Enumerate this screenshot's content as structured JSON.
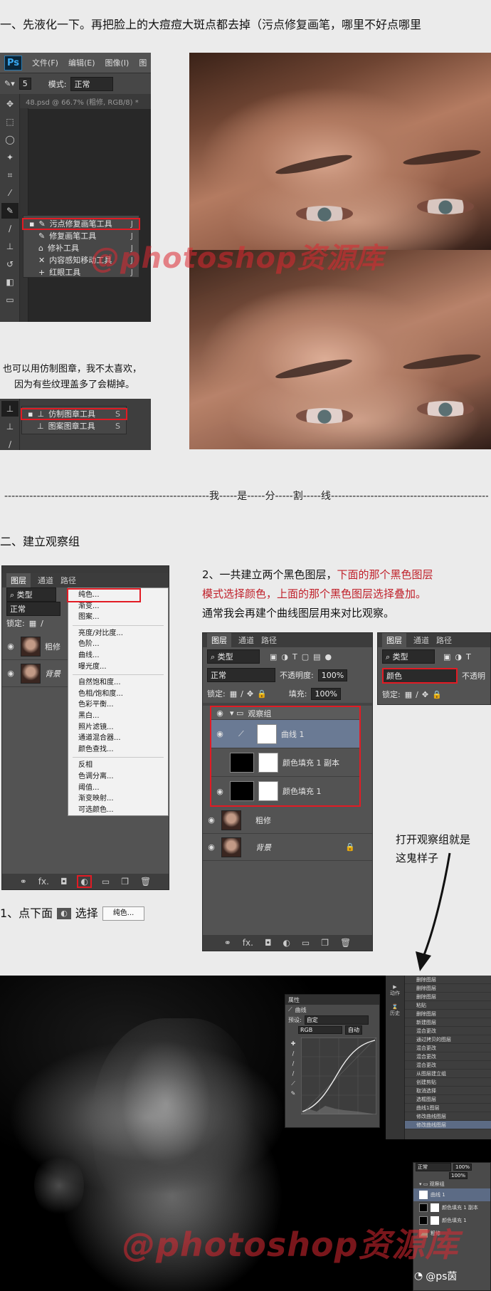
{
  "step1": {
    "heading": "一、先液化一下。再把脸上的大痘痘大斑点都去掉（污点修复画笔，哪里不好点哪里"
  },
  "ps_window1": {
    "app_logo": "Ps",
    "menu": [
      "文件(F)",
      "编辑(E)",
      "图像(I)",
      "图"
    ],
    "brush_size": "5",
    "mode_label": "模式:",
    "mode_value": "正常",
    "doc_tab": "48.psd @ 66.7% (粗修, RGB/8) *",
    "flyout_items": [
      {
        "label": "污点修复画笔工具",
        "key": "J"
      },
      {
        "label": "修复画笔工具",
        "key": "J"
      },
      {
        "label": "修补工具",
        "key": "J"
      },
      {
        "label": "内容感知移动工具",
        "key": "J"
      },
      {
        "label": "红眼工具",
        "key": "J"
      }
    ]
  },
  "note_clone": {
    "line1": "也可以用仿制图章，我不太喜欢，",
    "line2": "因为有些纹理盖多了会糊掉。",
    "flyout_items": [
      {
        "label": "仿制图章工具",
        "key": "S"
      },
      {
        "label": "图案图章工具",
        "key": "S"
      }
    ]
  },
  "watermark": "@photoshop资源库",
  "divider": {
    "text": "---------------------------------------------------------我-----是-----分-----割-----线--------------------------------------------------------------"
  },
  "step2": {
    "heading": "二、建立观察组",
    "panel_left": {
      "tabs": [
        "图层",
        "通道",
        "路径"
      ],
      "filter": "类型",
      "blend": "正常",
      "lock_label": "锁定:",
      "layers": [
        "粗修",
        "背景"
      ],
      "menu_items": [
        "纯色...",
        "渐变...",
        "图案...",
        "---",
        "亮度/对比度...",
        "色阶...",
        "曲线...",
        "曝光度...",
        "---",
        "自然饱和度...",
        "色相/饱和度...",
        "色彩平衡...",
        "黑白...",
        "照片滤镜...",
        "通道混合器...",
        "颜色查找...",
        "---",
        "反相",
        "色调分离...",
        "阈值...",
        "渐变映射...",
        "可选颜色..."
      ]
    },
    "caption1_prefix": "1、点下面",
    "caption1_middle": "选择",
    "caption1_button": "纯色...",
    "desc_part1": "2、一共建立两个黑色图层，",
    "desc_part2": "下面的那个黑色图层",
    "desc_part3": "模式选择颜色，上面的那个黑色图层选择叠加。",
    "desc_part4": "通常我会再建个曲线图层用来对比观察。",
    "panel_mid": {
      "tabs": [
        "图层",
        "通道",
        "路径"
      ],
      "filter": "类型",
      "blend": "正常",
      "opacity_label": "不透明度:",
      "opacity": "100%",
      "lock_label": "锁定:",
      "fill_label": "填充:",
      "fill": "100%",
      "group": "观察组",
      "group_layers": [
        "曲线 1",
        "颜色填充 1 副本",
        "颜色填充 1"
      ],
      "other_layers": [
        "粗修",
        "背景"
      ]
    },
    "panel_right": {
      "tabs": [
        "图层",
        "通道",
        "路径"
      ],
      "filter": "类型",
      "blend": "颜色",
      "opacity_label": "不透明",
      "lock_label": "锁定:"
    },
    "arrow_note_line1": "打开观察组就是",
    "arrow_note_line2": "这鬼样子"
  },
  "bottom": {
    "props_title": "属性",
    "curves_label": "曲线",
    "preset_label": "预设:",
    "preset_value": "自定",
    "channel_value": "RGB",
    "auto_label": "自动",
    "history_label": "动作",
    "history2_label": "历史",
    "history_items": [
      "删除图层",
      "删除图层",
      "删除图层",
      "粘贴",
      "删除图层",
      "新建图层",
      "混合更改",
      "通过拷贝的图层",
      "混合更改",
      "混合更改",
      "混合更改",
      "从图层建立组",
      "创建剪贴",
      "取消选择",
      "选框图层",
      "曲线1图层",
      "修改曲线图层",
      "修改曲线图层"
    ],
    "mini_layers": {
      "blend": "正常",
      "opacity": "100%",
      "fill": "100%",
      "group": "观察组",
      "rows": [
        "曲线 1",
        "颜色填充 1 副本",
        "颜色填充 1",
        "粗修"
      ]
    },
    "credit": "@ps茵"
  }
}
